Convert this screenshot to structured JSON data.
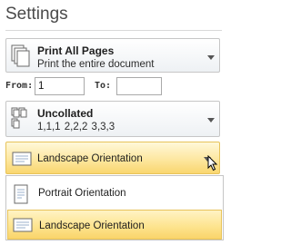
{
  "header": {
    "title": "Settings"
  },
  "print_what": {
    "main": "Print All Pages",
    "sub": "Print the entire document"
  },
  "pages": {
    "from_label": "From:",
    "from_value": "1",
    "to_label": "To:",
    "to_value": ""
  },
  "collation": {
    "main": "Uncollated",
    "sub": "1,1,1   2,2,2   3,3,3"
  },
  "orientation": {
    "selected": "Landscape Orientation",
    "options": [
      {
        "label": "Portrait Orientation"
      },
      {
        "label": "Landscape Orientation"
      }
    ]
  },
  "colors": {
    "highlight": "#fde38c",
    "highlight_border": "#e7c35a"
  }
}
